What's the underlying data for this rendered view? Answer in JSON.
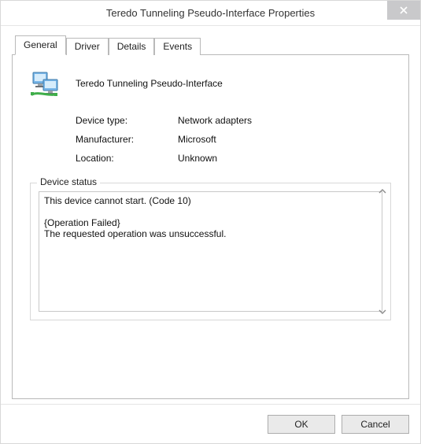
{
  "titlebar": {
    "title": "Teredo Tunneling Pseudo-Interface Properties"
  },
  "tabs": {
    "general": "General",
    "driver": "Driver",
    "details": "Details",
    "events": "Events"
  },
  "device": {
    "name": "Teredo Tunneling Pseudo-Interface",
    "type_label": "Device type:",
    "type_value": "Network adapters",
    "manufacturer_label": "Manufacturer:",
    "manufacturer_value": "Microsoft",
    "location_label": "Location:",
    "location_value": "Unknown"
  },
  "status": {
    "legend": "Device status",
    "text": "This device cannot start. (Code 10)\n\n{Operation Failed}\nThe requested operation was unsuccessful."
  },
  "buttons": {
    "ok": "OK",
    "cancel": "Cancel"
  }
}
